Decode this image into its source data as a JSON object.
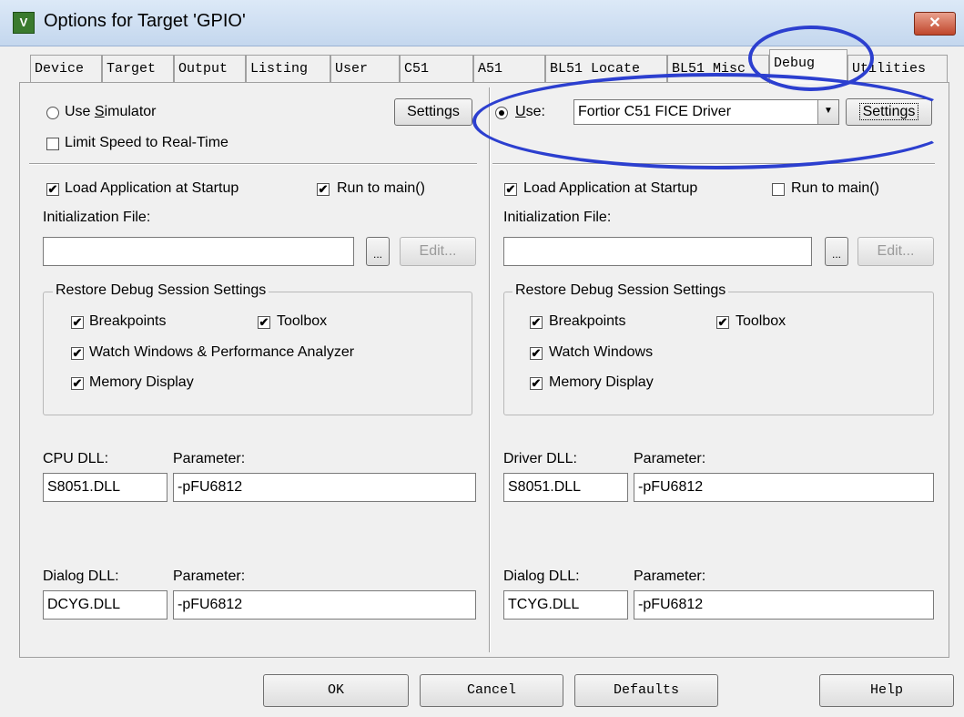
{
  "window": {
    "title": "Options for Target 'GPIO'",
    "icon_text": "V",
    "close_symbol": "✕"
  },
  "tabs": [
    {
      "label": "Device"
    },
    {
      "label": "Target"
    },
    {
      "label": "Output"
    },
    {
      "label": "Listing"
    },
    {
      "label": "User"
    },
    {
      "label": "C51"
    },
    {
      "label": "A51"
    },
    {
      "label": "BL51 Locate"
    },
    {
      "label": "BL51 Misc"
    },
    {
      "label": "Debug"
    },
    {
      "label": "Utilities"
    }
  ],
  "active_tab": "Debug",
  "left": {
    "use_simulator_label": "Use Simulator",
    "use_simulator_checked": false,
    "limit_speed_label": "Limit Speed to Real-Time",
    "limit_speed_checked": false,
    "settings_label": "Settings",
    "load_app_label": "Load Application at Startup",
    "load_app_checked": true,
    "run_to_main_label": "Run to main()",
    "run_to_main_checked": true,
    "init_file_label": "Initialization File:",
    "init_file_value": "",
    "browse_label": "...",
    "edit_label": "Edit...",
    "restore_group_label": "Restore Debug Session Settings",
    "breakpoints_label": "Breakpoints",
    "toolbox_label": "Toolbox",
    "watch_label": "Watch Windows & Performance Analyzer",
    "memory_label": "Memory Display",
    "cpu_dll_label": "CPU DLL:",
    "cpu_dll_value": "S8051.DLL",
    "cpu_param_label": "Parameter:",
    "cpu_param_value": "-pFU6812",
    "dialog_dll_label": "Dialog DLL:",
    "dialog_dll_value": "DCYG.DLL",
    "dialog_param_label": "Parameter:",
    "dialog_param_value": "-pFU6812"
  },
  "right": {
    "use_label": "Use:",
    "use_checked": true,
    "driver_select_value": "Fortior C51 FICE Driver",
    "settings_label": "Settings",
    "load_app_label": "Load Application at Startup",
    "load_app_checked": true,
    "run_to_main_label": "Run to main()",
    "run_to_main_checked": false,
    "init_file_label": "Initialization File:",
    "init_file_value": "",
    "browse_label": "...",
    "edit_label": "Edit...",
    "restore_group_label": "Restore Debug Session Settings",
    "breakpoints_label": "Breakpoints",
    "toolbox_label": "Toolbox",
    "watch_label": "Watch Windows",
    "memory_label": "Memory Display",
    "driver_dll_label": "Driver DLL:",
    "driver_dll_value": "S8051.DLL",
    "driver_param_label": "Parameter:",
    "driver_param_value": "-pFU6812",
    "dialog_dll_label": "Dialog DLL:",
    "dialog_dll_value": "TCYG.DLL",
    "dialog_param_label": "Parameter:",
    "dialog_param_value": "-pFU6812"
  },
  "footer": {
    "ok_label": "OK",
    "cancel_label": "Cancel",
    "defaults_label": "Defaults",
    "help_label": "Help"
  },
  "check_mark": "✔",
  "annotation_color": "#2c3fcf"
}
